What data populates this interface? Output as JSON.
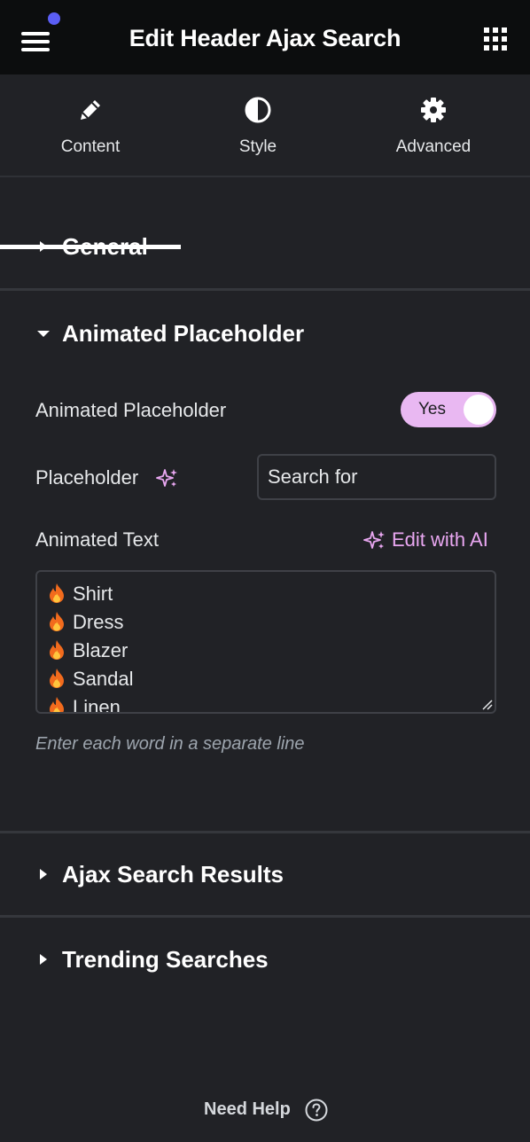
{
  "header": {
    "title": "Edit Header Ajax Search",
    "menu_icon": "hamburger-icon",
    "apps_icon": "grid-icon",
    "notification_color": "#5b5ef5"
  },
  "tabs": [
    {
      "label": "Content",
      "icon": "pencil-icon",
      "active": true
    },
    {
      "label": "Style",
      "icon": "contrast-icon",
      "active": false
    },
    {
      "label": "Advanced",
      "icon": "gear-icon",
      "active": false
    }
  ],
  "sections": {
    "general": {
      "label": "General",
      "expanded": false
    },
    "animated_placeholder": {
      "label": "Animated Placeholder",
      "expanded": true,
      "toggle_label": "Animated Placeholder",
      "toggle_value": "Yes",
      "placeholder_label": "Placeholder",
      "placeholder_value": "Search for",
      "animated_text_label": "Animated Text",
      "edit_ai_label": "Edit with AI",
      "animated_words": [
        "Shirt",
        "Dress",
        "Blazer",
        "Sandal",
        "Linen"
      ],
      "hint": "Enter each word in a separate line"
    },
    "ajax_results": {
      "label": "Ajax Search Results",
      "expanded": false
    },
    "trending": {
      "label": "Trending Searches",
      "expanded": false
    }
  },
  "footer": {
    "help_label": "Need Help",
    "help_icon": "question-circle-icon"
  },
  "colors": {
    "accent": "#e9b8f2",
    "ai_link": "#e9a7f1",
    "background": "#212226",
    "topbar": "#0c0d0e"
  }
}
